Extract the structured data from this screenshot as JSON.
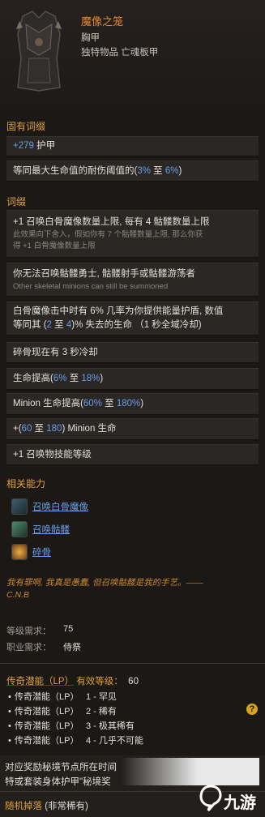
{
  "item": {
    "name": "魔像之笼",
    "type": "胸甲",
    "class": "独特物品 亡魂板甲"
  },
  "implicit": {
    "title": "固有词缀",
    "armor_value": "+279",
    "armor_label": "护甲",
    "resist_pre": "等同最大生命值的耐伤阈值的(",
    "resist_lo": "3%",
    "resist_mid": "至",
    "resist_hi": "6%",
    "resist_post": ")"
  },
  "affixes": {
    "title": "词缀",
    "a1_line1": "+1 召唤白骨魔像数量上限, 每有 4 骷髅数量上限",
    "a1_sub1": "此效果向下舍入，假如你有 7 个骷髅数量上限, 那么你获",
    "a1_sub2": "得 +1 白骨魔像数量上限",
    "a2_line1": "你无法召唤骷髅勇士, 骷髅射手或骷髅游荡者",
    "a2_sub": "Other skeletal minions can still be summoned",
    "a3_line1": "白骨魔像击中时有 6% 几率为你提供能量护盾, 数值",
    "a3_line2_pre": "等同其 (",
    "a3_lo": "2",
    "a3_mid": "至",
    "a3_hi": "4",
    "a3_line2_post": ")% 失去的生命 （1 秒全域冷却)",
    "a4": "碎骨现在有 3 秒冷却",
    "a5_pre": "生命提高(",
    "a5_lo": "6%",
    "a5_mid": "至",
    "a5_hi": "18%",
    "a5_post": ")",
    "a6_pre": "Minion 生命提高(",
    "a6_lo": "60%",
    "a6_mid": "至",
    "a6_hi": "180%",
    "a6_post": ")",
    "a7_pre": "+(",
    "a7_lo": "60",
    "a7_mid": "至",
    "a7_hi": "180",
    "a7_post": ") Minion 生命",
    "a8": "+1 召唤物技能等级"
  },
  "skills": {
    "title": "相关能力",
    "s1": "召唤白骨魔像",
    "s2": "召唤骷髅",
    "s3": "碎骨"
  },
  "quote": {
    "line1": "我有罪啊, 我真是愚蠢, 但召唤骷髅是我的手艺。——",
    "line2": "C.N.B"
  },
  "requirements": {
    "level_label": "等级需求：",
    "level_value": "75",
    "class_label": "职业需求：",
    "class_value": "侍祭"
  },
  "legendary": {
    "title_a": "传奇潜能（LP）",
    "title_b": "有效等级：",
    "value": "60",
    "items": [
      {
        "label": "传奇潜能（LP）",
        "text": "1 - 罕见"
      },
      {
        "label": "传奇潜能（LP）",
        "text": "2 - 稀有"
      },
      {
        "label": "传奇潜能（LP）",
        "text": "3 - 极其稀有"
      },
      {
        "label": "传奇潜能（LP）",
        "text": "4 - 几乎不可能"
      }
    ],
    "help": "?"
  },
  "footer": {
    "line1": "对应奖励秘境节点所在时间",
    "line2": "特或套装身体护甲\"秘境奖",
    "drop_label": "随机掉落",
    "drop_value": " (非常稀有)"
  },
  "watermark": {
    "text": "九游"
  }
}
